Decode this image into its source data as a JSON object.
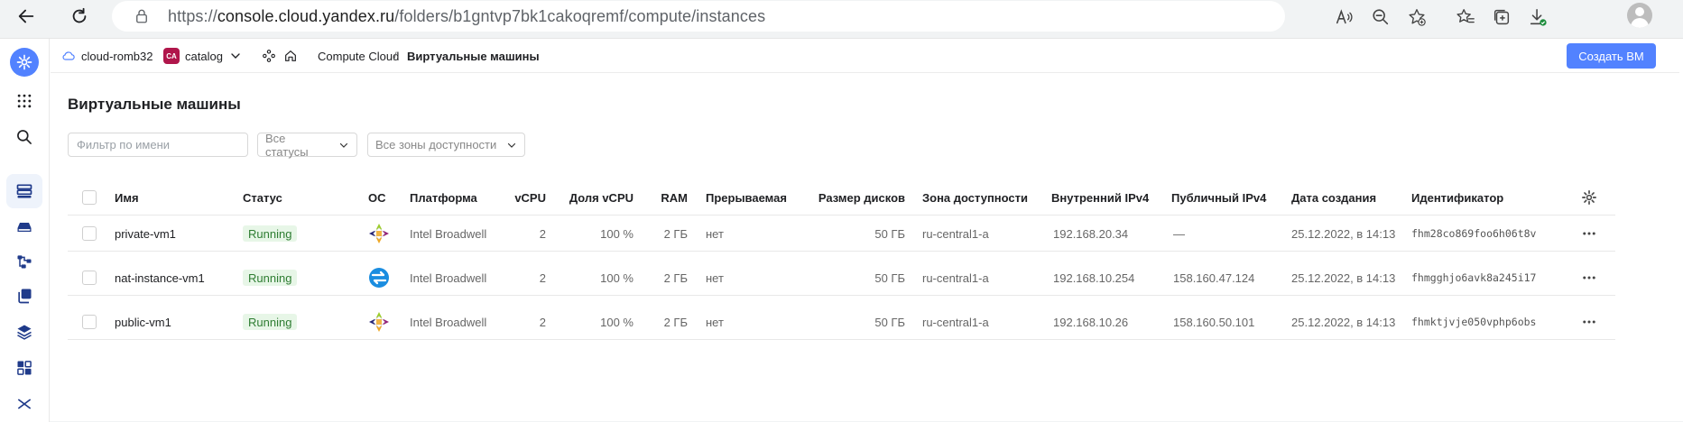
{
  "browser": {
    "url": {
      "scheme": "https://",
      "host": "console.cloud.yandex.ru",
      "path": "/folders/b1gntvp7bk1cakoqremf/compute/instances"
    }
  },
  "header": {
    "cloud": "cloud-romb32",
    "folder_badge": "CA",
    "folder": "catalog",
    "service": "Compute Cloud",
    "separator": "/",
    "current": "Виртуальные машины",
    "create_button": "Создать ВМ"
  },
  "page": {
    "title": "Виртуальные машины",
    "filter_placeholder": "Фильтр по имени",
    "status_select": "Все статусы",
    "zone_select": "Все зоны доступности"
  },
  "table": {
    "columns": {
      "name": "Имя",
      "status": "Статус",
      "os": "ОС",
      "platform": "Платформа",
      "vcpu": "vCPU",
      "vcpu_share": "Доля vCPU",
      "ram": "RAM",
      "preemptible": "Прерываемая",
      "disk_size": "Размер дисков",
      "zone": "Зона доступности",
      "internal_ip": "Внутренний IPv4",
      "public_ip": "Публичный IPv4",
      "created": "Дата создания",
      "id": "Идентификатор"
    },
    "rows": [
      {
        "name": "private-vm1",
        "status": "Running",
        "os_icon": "centos-icon",
        "platform": "Intel Broadwell",
        "vcpu": "2",
        "vcpu_share": "100 %",
        "ram": "2 ГБ",
        "preemptible": "нет",
        "disk_size": "50 ГБ",
        "zone": "ru-central1-a",
        "internal_ip": "192.168.20.34",
        "public_ip": "—",
        "created": "25.12.2022, в 14:13",
        "id": "fhm28co869foo6h06t8v"
      },
      {
        "name": "nat-instance-vm1",
        "status": "Running",
        "os_icon": "nat-instance-icon",
        "platform": "Intel Broadwell",
        "vcpu": "2",
        "vcpu_share": "100 %",
        "ram": "2 ГБ",
        "preemptible": "нет",
        "disk_size": "50 ГБ",
        "zone": "ru-central1-a",
        "internal_ip": "192.168.10.254",
        "public_ip": "158.160.47.124",
        "created": "25.12.2022, в 14:13",
        "id": "fhmgghjo6avk8a245i17"
      },
      {
        "name": "public-vm1",
        "status": "Running",
        "os_icon": "centos-icon",
        "platform": "Intel Broadwell",
        "vcpu": "2",
        "vcpu_share": "100 %",
        "ram": "2 ГБ",
        "preemptible": "нет",
        "disk_size": "50 ГБ",
        "zone": "ru-central1-a",
        "internal_ip": "192.168.10.26",
        "public_ip": "158.160.50.101",
        "created": "25.12.2022, в 14:13",
        "id": "fhmktjvje050vphp6obs"
      }
    ]
  },
  "colors": {
    "accent": "#5282ff",
    "running_bg": "#e7f6e7",
    "running_text": "#2e7d32",
    "folder_badge": "#b0164b"
  }
}
